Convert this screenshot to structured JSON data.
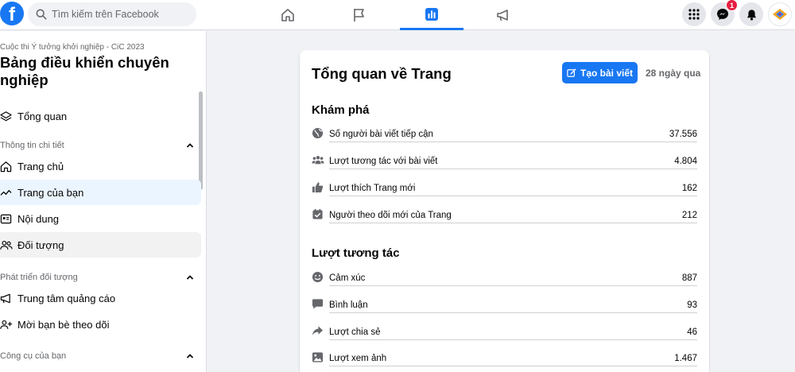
{
  "topbar": {
    "logo": "f",
    "search_placeholder": "Tìm kiếm trên Facebook",
    "nav_tabs": [
      {
        "icon": "home-icon"
      },
      {
        "icon": "flag-icon"
      },
      {
        "icon": "insights-icon",
        "active": true
      },
      {
        "icon": "megaphone-icon"
      }
    ],
    "messenger_badge": "1"
  },
  "sidebar": {
    "subtitle": "Cuộc thi Ý tưởng khởi nghiệp - CiC 2023",
    "title": "Bảng điều khiển chuyên nghiệp",
    "overview": "Tổng quan",
    "sections": {
      "insights": "Thông tin chi tiết",
      "grow": "Phát triển đối tượng",
      "tools": "Công cụ của bạn"
    },
    "items": {
      "home": "Trang chủ",
      "your_page": "Trang của bạn",
      "content": "Nội dung",
      "audience": "Đối tượng",
      "ad_center": "Trung tâm quảng cáo",
      "invite": "Mời bạn bè theo dõi"
    }
  },
  "card": {
    "title": "Tổng quan về Trang",
    "create_label": "Tạo bài viết",
    "period": "28 ngày qua",
    "discover": {
      "title": "Khám phá",
      "rows": [
        {
          "label": "Số người bài viết tiếp cận",
          "value": "37.556"
        },
        {
          "label": "Lượt tương tác với bài viết",
          "value": "4.804"
        },
        {
          "label": "Lượt thích Trang mới",
          "value": "162"
        },
        {
          "label": "Người theo dõi mới của Trang",
          "value": "212"
        }
      ]
    },
    "interactions": {
      "title": "Lượt tương tác",
      "rows": [
        {
          "label": "Cảm xúc",
          "value": "887"
        },
        {
          "label": "Bình luận",
          "value": "93"
        },
        {
          "label": "Lượt chia sẻ",
          "value": "46"
        },
        {
          "label": "Lượt xem ảnh",
          "value": "1.467"
        }
      ]
    }
  },
  "colors": {
    "brand": "#1877f2",
    "badge": "#e41e3f",
    "selected_bg": "#ebf5ff"
  }
}
